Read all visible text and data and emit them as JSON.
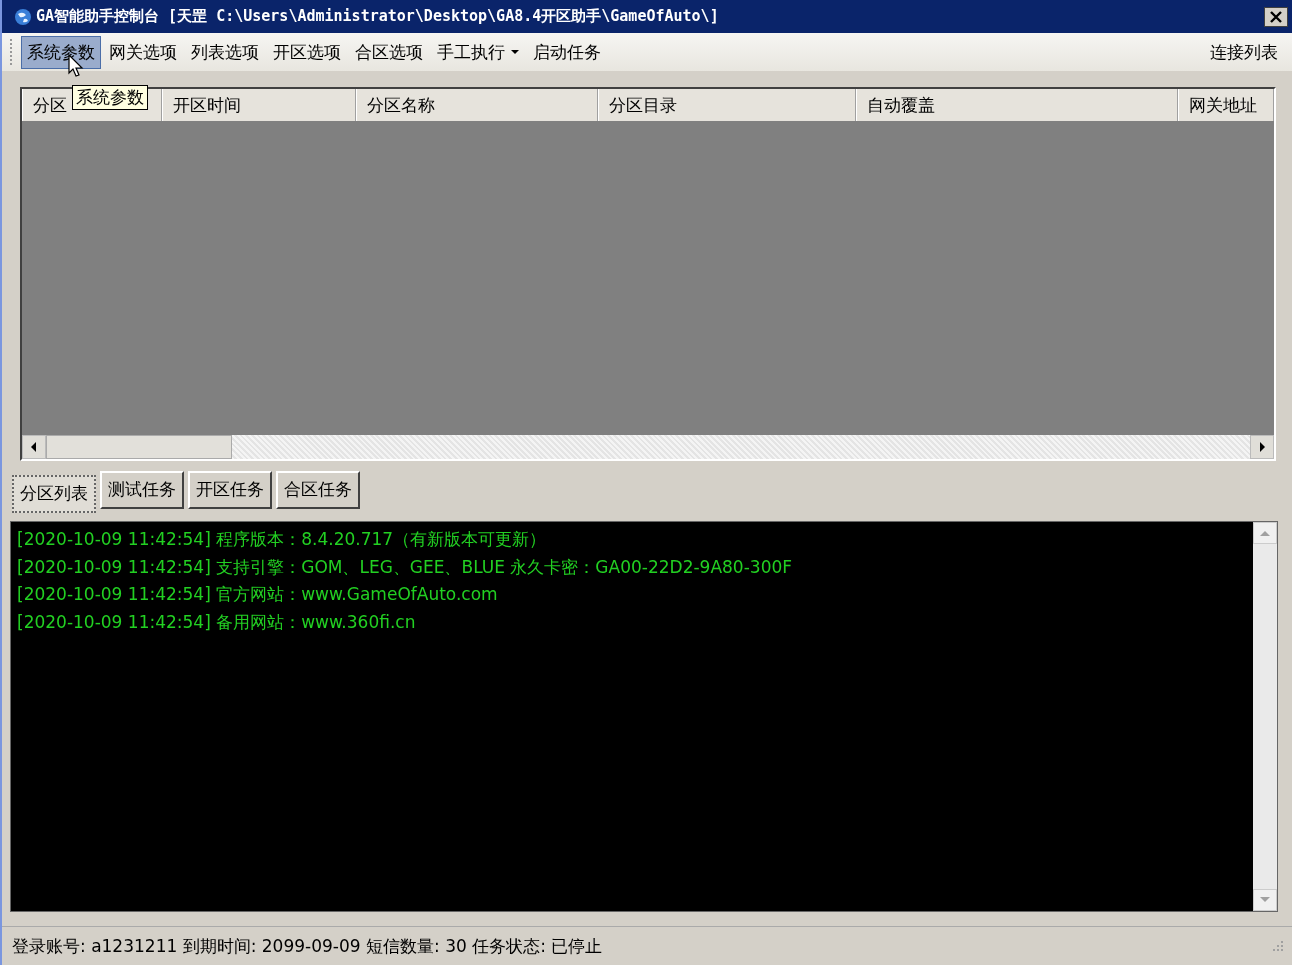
{
  "window": {
    "title": "GA智能助手控制台 [天罡 C:\\Users\\Administrator\\Desktop\\GA8.4开区助手\\GameOfAuto\\]"
  },
  "menu": {
    "items": [
      {
        "label": "系统参数",
        "kind": "plain",
        "hovered": true
      },
      {
        "label": "网关选项",
        "kind": "plain",
        "hovered": false
      },
      {
        "label": "列表选项",
        "kind": "plain",
        "hovered": false
      },
      {
        "label": "开区选项",
        "kind": "plain",
        "hovered": false
      },
      {
        "label": "合区选项",
        "kind": "plain",
        "hovered": false
      },
      {
        "label": "手工执行",
        "kind": "dropdown",
        "hovered": false
      },
      {
        "label": "启动任务",
        "kind": "plain",
        "hovered": false
      }
    ],
    "right_item": "连接列表"
  },
  "tooltip": "系统参数",
  "table": {
    "columns": [
      "分区",
      "开区时间",
      "分区名称",
      "分区目录",
      "自动覆盖",
      "网关地址"
    ]
  },
  "tabs": [
    {
      "label": "分区列表",
      "selected": true
    },
    {
      "label": "测试任务",
      "selected": false
    },
    {
      "label": "开区任务",
      "selected": false
    },
    {
      "label": "合区任务",
      "selected": false
    }
  ],
  "log": [
    "[2020-10-09 11:42:54] 程序版本：8.4.20.717（有新版本可更新）",
    "[2020-10-09 11:42:54] 支持引擎：GOM、LEG、GEE、BLUE 永久卡密：GA00-22D2-9A80-300F",
    "[2020-10-09 11:42:54] 官方网站：www.GameOfAuto.com",
    "[2020-10-09 11:42:54] 备用网站：www.360fi.cn"
  ],
  "status_bar": "登录账号: a1231211 到期时间: 2099-09-09 短信数量: 30 任务状态: 已停止"
}
